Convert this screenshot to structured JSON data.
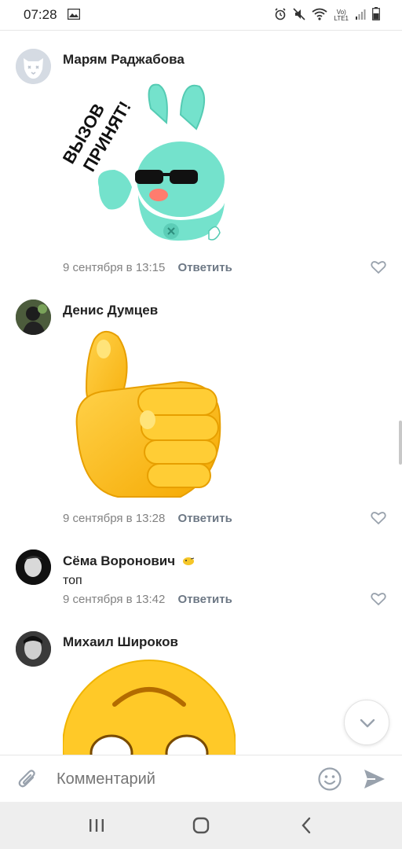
{
  "status_bar": {
    "time": "07:28",
    "network_label_top": "Vo)",
    "network_label_bottom": "LTE1"
  },
  "comments": [
    {
      "author": "Марям Раджабова",
      "type": "sticker",
      "sticker_text_line1": "ВЫЗОВ",
      "sticker_text_line2": "ПРИНЯТ!",
      "date": "9 сентября в 13:15",
      "reply": "Ответить"
    },
    {
      "author": "Денис Думцев",
      "type": "sticker",
      "date": "9 сентября в 13:28",
      "reply": "Ответить"
    },
    {
      "author": "Сёма Воронович",
      "type": "text",
      "text": "топ",
      "date": "9 сентября в 13:42",
      "reply": "Ответить"
    },
    {
      "author": "Михаил Широков",
      "type": "sticker"
    }
  ],
  "composer": {
    "placeholder": "Комментарий"
  },
  "colors": {
    "accent": "#5181b8",
    "secondary_text": "#828282",
    "icon": "#99a2ad"
  }
}
